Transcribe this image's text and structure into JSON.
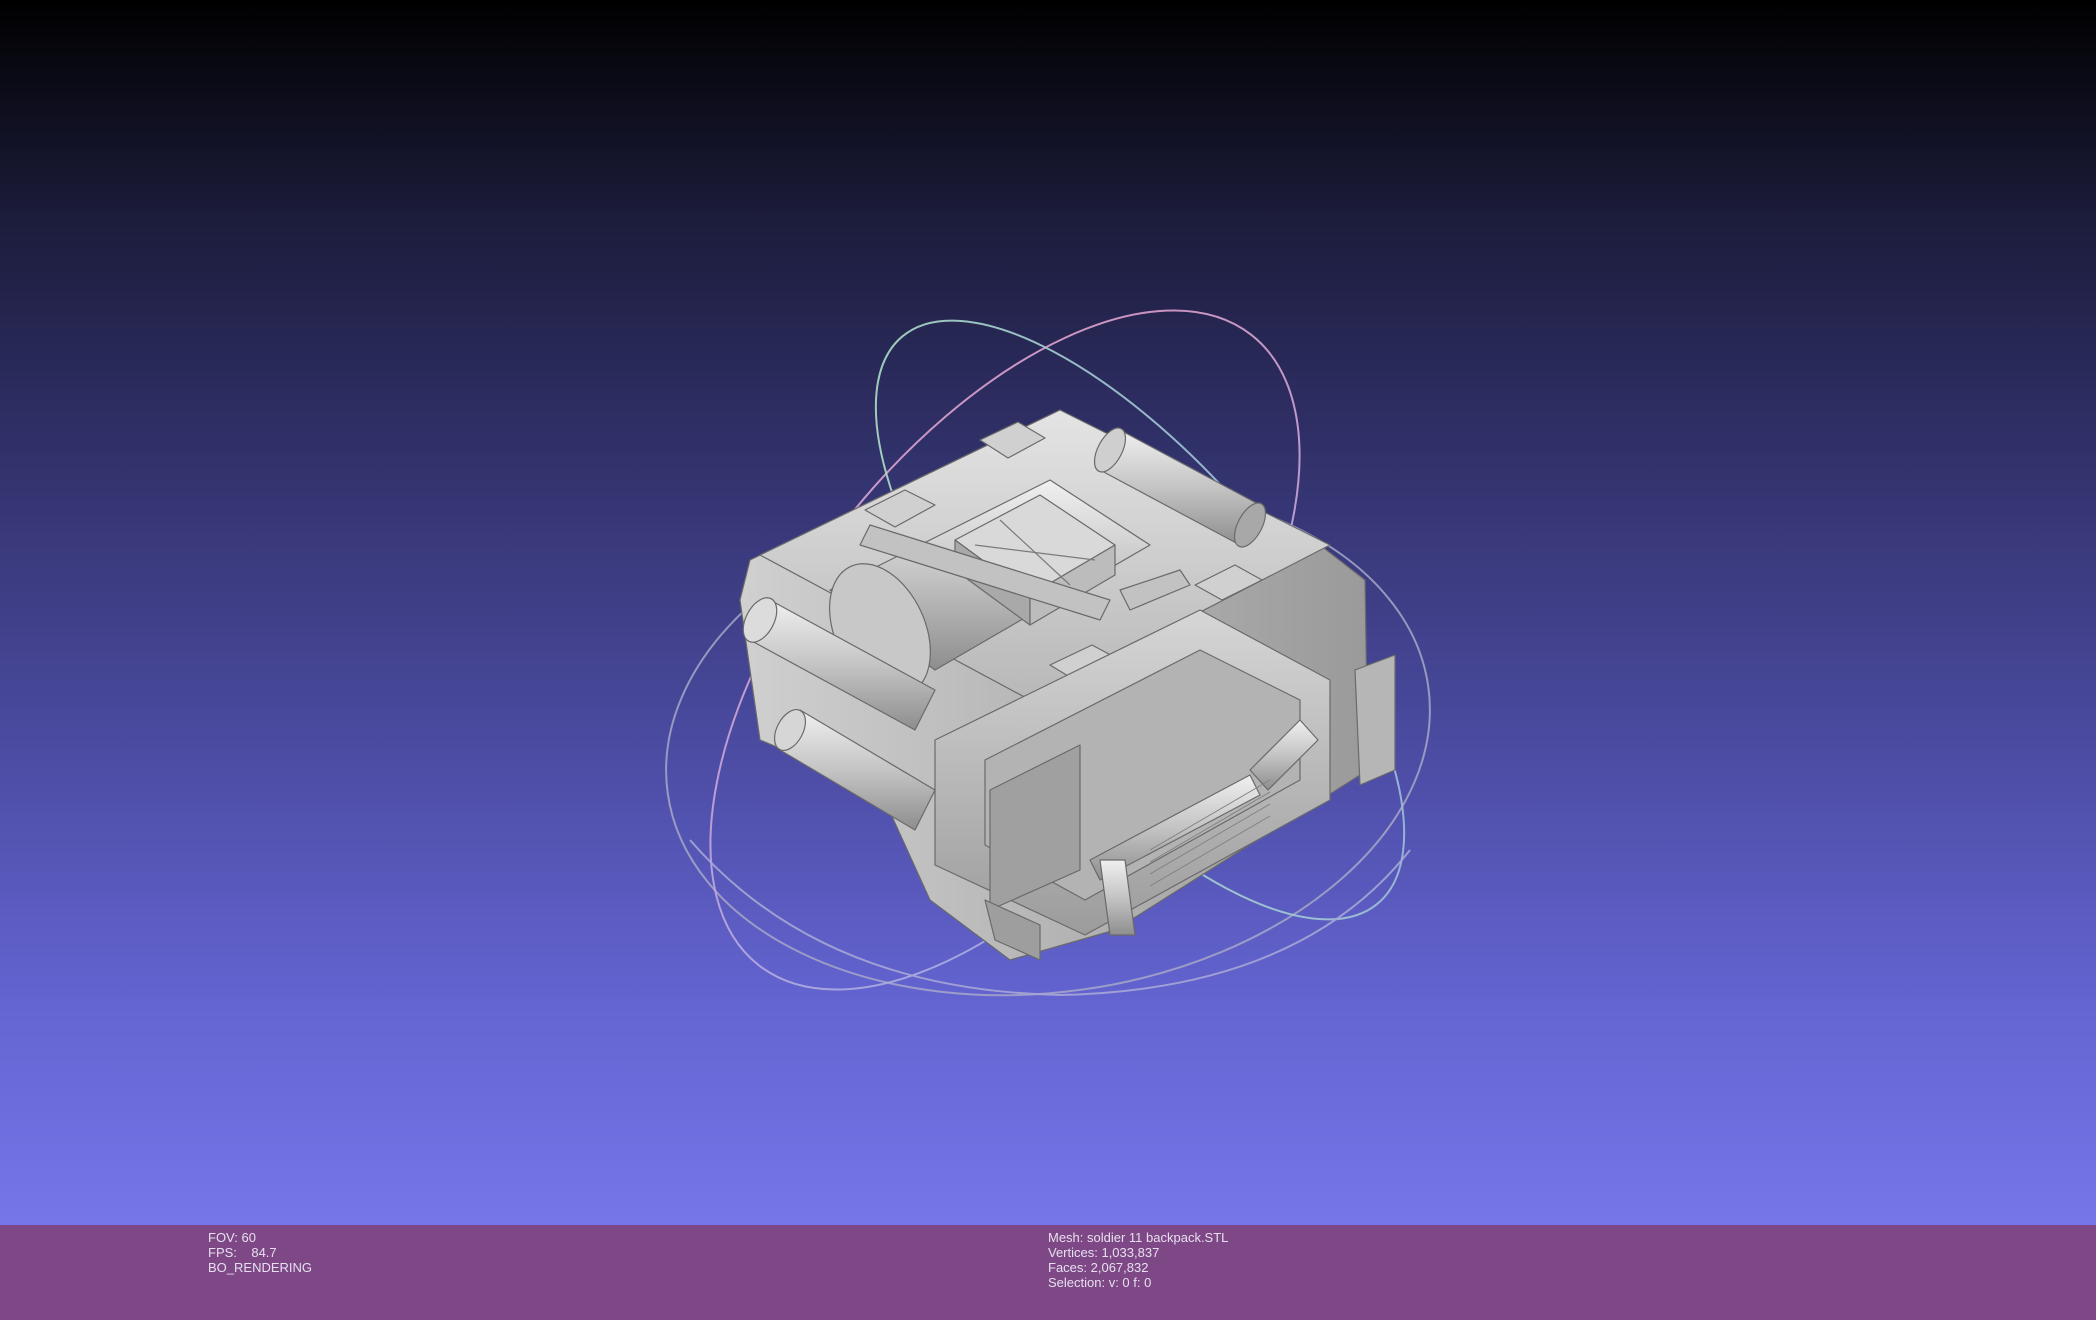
{
  "viewer": {
    "fov_label": "FOV: 60",
    "fps_label": "FPS:    84.7",
    "render_mode": "BO_RENDERING"
  },
  "mesh": {
    "name_label": "Mesh: soldier 11 backpack.STL",
    "vertices_label": "Vertices: 1,033,837",
    "faces_label": "Faces: 2,067,832",
    "selection_label": "Selection: v: 0 f: 0"
  },
  "colors": {
    "background_top": "#000000",
    "background_bottom": "#7676ea",
    "info_bar": "#7e4887",
    "mesh_shade": "#bdbdbd"
  }
}
